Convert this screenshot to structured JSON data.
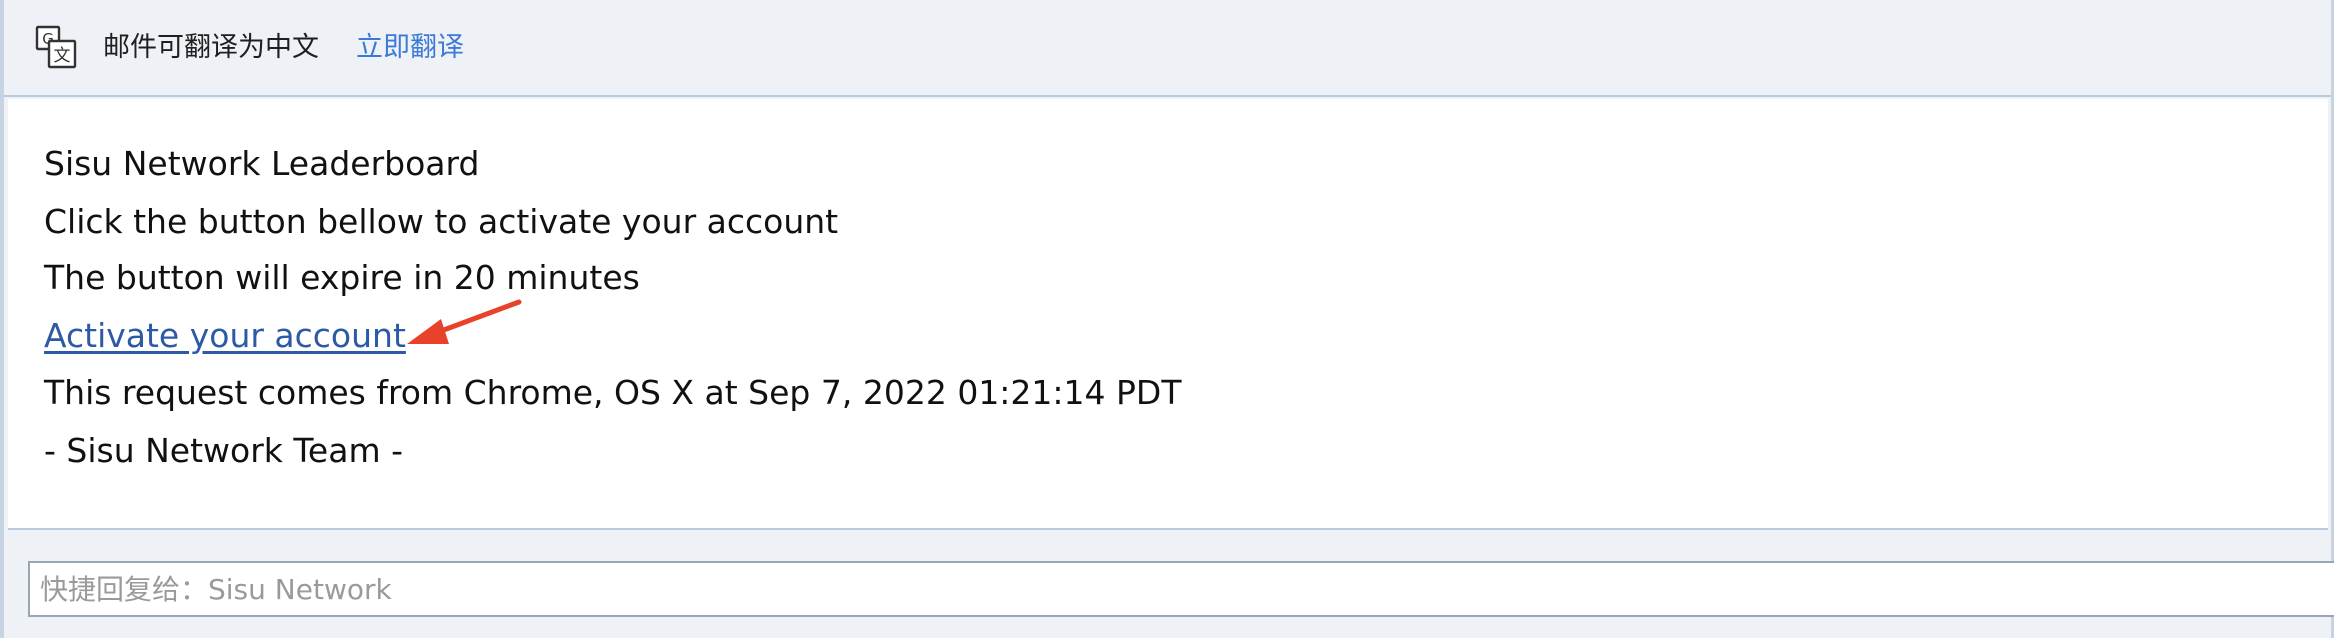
{
  "translate_bar": {
    "icon": "translate-icon",
    "notice": "邮件可翻译为中文",
    "action_label": "立即翻译"
  },
  "email": {
    "lines": [
      "Sisu Network Leaderboard",
      "Click the button bellow to activate your account",
      "The button will expire in 20 minutes",
      "Activate your account",
      "This request comes from Chrome, OS X at Sep 7, 2022 01:21:14 PDT",
      "- Sisu Network Team -"
    ],
    "link_color": "#2d5aa5",
    "annotation_arrow_color": "#e8432a"
  },
  "quick_reply": {
    "placeholder": "快捷回复给：Sisu Network",
    "value": ""
  }
}
